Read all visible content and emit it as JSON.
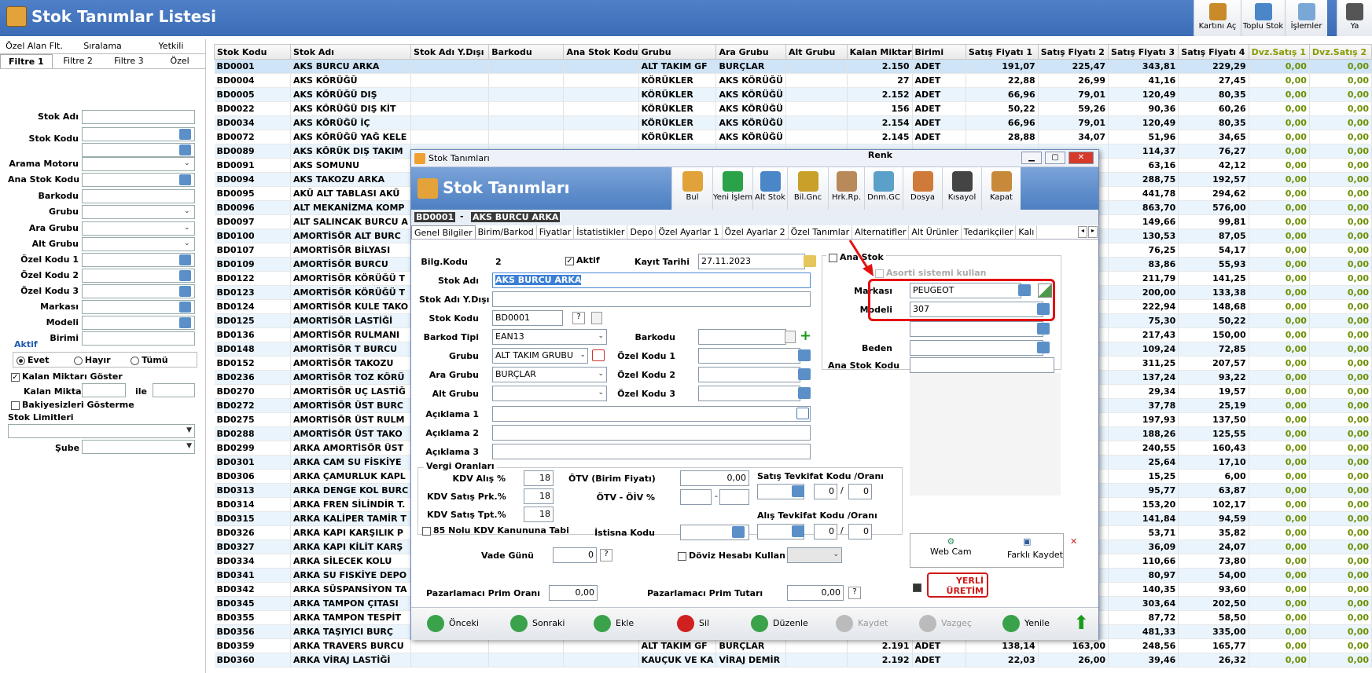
{
  "window": {
    "title": "Stok Tanımlar Listesi"
  },
  "toolbar": [
    {
      "label": "Kartını Aç"
    },
    {
      "label": "Toplu Stok"
    },
    {
      "label": "İşlemler"
    },
    {
      "label": "Ya"
    }
  ],
  "filter": {
    "tabs_top": [
      "Özel Alan Flt.",
      "Sıralama",
      "Yetkili"
    ],
    "tabs_bottom": [
      "Filtre 1",
      "Filtre 2",
      "Filtre 3",
      "Özel"
    ],
    "fields": [
      "Stok Adı",
      "Stok Kodu",
      "Arama Motoru",
      "Ana Stok Kodu",
      "Barkodu",
      "Grubu",
      "Ara Grubu",
      "Alt Grubu",
      "Özel Kodu 1",
      "Özel Kodu 2",
      "Özel Kodu 3",
      "Markası",
      "Modeli",
      "Birimi"
    ],
    "aktif_title": "Aktif",
    "aktif_options": [
      "Evet",
      "Hayır",
      "Tümü"
    ],
    "kalan_goster": "Kalan Miktarı Göster",
    "kalan_miktar": "Kalan Miktar",
    "ile": "ile",
    "bakiyesiz": "Bakiyesizleri Gösterme",
    "stok_limitleri": "Stok Limitleri",
    "sube": "Şube"
  },
  "grid": {
    "columns": [
      "Stok Kodu",
      "Stok Adı",
      "Stok Adı Y.Dışı",
      "Barkodu",
      "Ana Stok Kodu",
      "Grubu",
      "Ara Grubu",
      "Alt Grubu",
      "Kalan Miktar",
      "Birimi",
      "Satış Fiyatı 1",
      "Satış Fiyatı 2",
      "Satış Fiyatı 3",
      "Satış Fiyatı 4",
      "Dvz.Satış 1",
      "Dvz.Satış 2"
    ],
    "rows": [
      [
        "BD0001",
        "AKS BURCU ARKA",
        "",
        "",
        "",
        "ALT TAKIM GF",
        "BURÇLAR",
        "",
        "2.150",
        "ADET",
        "191,07",
        "225,47",
        "343,81",
        "229,29",
        "0,00",
        "0,00"
      ],
      [
        "BD0004",
        "AKS KÖRÜĞÜ",
        "",
        "",
        "",
        "KÖRÜKLER",
        "AKS KÖRÜĞÜ",
        "",
        "27",
        "ADET",
        "22,88",
        "26,99",
        "41,16",
        "27,45",
        "0,00",
        "0,00"
      ],
      [
        "BD0005",
        "AKS KÖRÜĞÜ DIŞ",
        "",
        "",
        "",
        "KÖRÜKLER",
        "AKS KÖRÜĞÜ",
        "",
        "2.152",
        "ADET",
        "66,96",
        "79,01",
        "120,49",
        "80,35",
        "0,00",
        "0,00"
      ],
      [
        "BD0022",
        "AKS KÖRÜĞÜ DIŞ KİT",
        "",
        "",
        "",
        "KÖRÜKLER",
        "AKS KÖRÜĞÜ",
        "",
        "156",
        "ADET",
        "50,22",
        "59,26",
        "90,36",
        "60,26",
        "0,00",
        "0,00"
      ],
      [
        "BD0034",
        "AKS KÖRÜĞÜ İÇ",
        "",
        "",
        "",
        "KÖRÜKLER",
        "AKS KÖRÜĞÜ",
        "",
        "2.154",
        "ADET",
        "66,96",
        "79,01",
        "120,49",
        "80,35",
        "0,00",
        "0,00"
      ],
      [
        "BD0072",
        "AKS KÖRÜĞÜ YAĞ KELE",
        "",
        "",
        "",
        "KÖRÜKLER",
        "AKS KÖRÜĞÜ",
        "",
        "2.145",
        "ADET",
        "28,88",
        "34,07",
        "51,96",
        "34,65",
        "0,00",
        "0,00"
      ],
      [
        "BD0089",
        "AKS KÖRÜK DIŞ TAKIM",
        "",
        "",
        "",
        "",
        "",
        "",
        "",
        "",
        "",
        "",
        "114,37",
        "76,27",
        "0,00",
        "0,00"
      ],
      [
        "BD0091",
        "AKS SOMUNU",
        "",
        "",
        "",
        "",
        "",
        "",
        "",
        "",
        "",
        "",
        "63,16",
        "42,12",
        "0,00",
        "0,00"
      ],
      [
        "BD0094",
        "AKS TAKOZU ARKA",
        "",
        "",
        "",
        "",
        "",
        "",
        "",
        "",
        "",
        "",
        "288,75",
        "192,57",
        "0,00",
        "0,00"
      ],
      [
        "BD0095",
        "AKÜ ALT TABLASI AKÜ",
        "",
        "",
        "",
        "",
        "",
        "",
        "",
        "",
        "",
        "",
        "441,78",
        "294,62",
        "0,00",
        "0,00"
      ],
      [
        "BD0096",
        "ALT MEKANİZMA KOMP",
        "",
        "",
        "",
        "",
        "",
        "",
        "",
        "",
        "",
        "",
        "863,70",
        "576,00",
        "0,00",
        "0,00"
      ],
      [
        "BD0097",
        "ALT SALINCAK BURCU A",
        "",
        "",
        "",
        "",
        "",
        "",
        "",
        "",
        "",
        "",
        "149,66",
        "99,81",
        "0,00",
        "0,00"
      ],
      [
        "BD0100",
        "AMORTİSÖR ALT BURC",
        "",
        "",
        "",
        "",
        "",
        "",
        "",
        "",
        "",
        "",
        "130,53",
        "87,05",
        "0,00",
        "0,00"
      ],
      [
        "BD0107",
        "AMORTİSÖR BİLYASI",
        "",
        "",
        "",
        "",
        "",
        "",
        "",
        "",
        "",
        "",
        "76,25",
        "54,17",
        "0,00",
        "0,00"
      ],
      [
        "BD0109",
        "AMORTİSÖR BURCU",
        "",
        "",
        "",
        "",
        "",
        "",
        "",
        "",
        "",
        "",
        "83,86",
        "55,93",
        "0,00",
        "0,00"
      ],
      [
        "BD0122",
        "AMORTİSÖR KÖRÜĞÜ T",
        "",
        "",
        "",
        "",
        "",
        "",
        "",
        "",
        "",
        "",
        "211,79",
        "141,25",
        "0,00",
        "0,00"
      ],
      [
        "BD0123",
        "AMORTİSÖR KÖRÜĞÜ T",
        "",
        "",
        "",
        "",
        "",
        "",
        "",
        "",
        "",
        "",
        "200,00",
        "133,38",
        "0,00",
        "0,00"
      ],
      [
        "BD0124",
        "AMORTİSÖR KULE TAKO",
        "",
        "",
        "",
        "",
        "",
        "",
        "",
        "",
        "",
        "",
        "222,94",
        "148,68",
        "0,00",
        "0,00"
      ],
      [
        "BD0125",
        "AMORTİSÖR LASTİĞİ",
        "",
        "",
        "",
        "",
        "",
        "",
        "",
        "",
        "",
        "",
        "75,30",
        "50,22",
        "0,00",
        "0,00"
      ],
      [
        "BD0136",
        "AMORTİSÖR RULMANI",
        "",
        "",
        "",
        "",
        "",
        "",
        "",
        "",
        "",
        "",
        "217,43",
        "150,00",
        "0,00",
        "0,00"
      ],
      [
        "BD0148",
        "AMORTİSÖR T BURCU",
        "",
        "",
        "",
        "",
        "",
        "",
        "",
        "",
        "",
        "",
        "109,24",
        "72,85",
        "0,00",
        "0,00"
      ],
      [
        "BD0152",
        "AMORTİSÖR TAKOZU",
        "",
        "",
        "",
        "",
        "",
        "",
        "",
        "",
        "",
        "",
        "311,25",
        "207,57",
        "0,00",
        "0,00"
      ],
      [
        "BD0236",
        "AMORTİSÖR TOZ KÖRÜ",
        "",
        "",
        "",
        "",
        "",
        "",
        "",
        "",
        "",
        "",
        "137,24",
        "93,22",
        "0,00",
        "0,00"
      ],
      [
        "BD0270",
        "AMORTİSÖR UÇ LASTİĞ",
        "",
        "",
        "",
        "",
        "",
        "",
        "",
        "",
        "",
        "",
        "29,34",
        "19,57",
        "0,00",
        "0,00"
      ],
      [
        "BD0272",
        "AMORTİSÖR ÜST BURC",
        "",
        "",
        "",
        "",
        "",
        "",
        "",
        "",
        "",
        "",
        "37,78",
        "25,19",
        "0,00",
        "0,00"
      ],
      [
        "BD0275",
        "AMORTİSÖR ÜST RULM",
        "",
        "",
        "",
        "",
        "",
        "",
        "",
        "",
        "",
        "",
        "197,93",
        "137,50",
        "0,00",
        "0,00"
      ],
      [
        "BD0288",
        "AMORTİSÖR ÜST TAKO",
        "",
        "",
        "",
        "",
        "",
        "",
        "",
        "",
        "",
        "",
        "188,26",
        "125,55",
        "0,00",
        "0,00"
      ],
      [
        "BD0299",
        "ARKA AMORTİSÖR ÜST",
        "",
        "",
        "",
        "",
        "",
        "",
        "",
        "",
        "",
        "",
        "240,55",
        "160,43",
        "0,00",
        "0,00"
      ],
      [
        "BD0301",
        "ARKA CAM SU FİSKİYE",
        "",
        "",
        "",
        "",
        "",
        "",
        "",
        "",
        "",
        "",
        "25,64",
        "17,10",
        "0,00",
        "0,00"
      ],
      [
        "BD0306",
        "ARKA ÇAMURLUK KAPL",
        "",
        "",
        "",
        "",
        "",
        "",
        "",
        "",
        "",
        "",
        "15,25",
        "6,00",
        "0,00",
        "0,00"
      ],
      [
        "BD0313",
        "ARKA DENGE KOL BURC",
        "",
        "",
        "",
        "",
        "",
        "",
        "",
        "",
        "",
        "",
        "95,77",
        "63,87",
        "0,00",
        "0,00"
      ],
      [
        "BD0314",
        "ARKA FREN SİLİNDİR T.",
        "",
        "",
        "",
        "",
        "",
        "",
        "",
        "",
        "",
        "",
        "153,20",
        "102,17",
        "0,00",
        "0,00"
      ],
      [
        "BD0315",
        "ARKA KALİPER TAMİR T",
        "",
        "",
        "",
        "",
        "",
        "",
        "",
        "",
        "",
        "",
        "141,84",
        "94,59",
        "0,00",
        "0,00"
      ],
      [
        "BD0326",
        "ARKA KAPI KARŞILIK P",
        "",
        "",
        "",
        "",
        "",
        "",
        "",
        "",
        "",
        "",
        "53,71",
        "35,82",
        "0,00",
        "0,00"
      ],
      [
        "BD0327",
        "ARKA KAPI KİLİT KARŞ",
        "",
        "",
        "",
        "",
        "",
        "",
        "",
        "",
        "",
        "",
        "36,09",
        "24,07",
        "0,00",
        "0,00"
      ],
      [
        "BD0334",
        "ARKA SİLECEK KOLU",
        "",
        "",
        "",
        "",
        "",
        "",
        "",
        "",
        "",
        "",
        "110,66",
        "73,80",
        "0,00",
        "0,00"
      ],
      [
        "BD0341",
        "ARKA SU FISKİYE DEPO",
        "",
        "",
        "",
        "",
        "",
        "",
        "",
        "",
        "",
        "",
        "80,97",
        "54,00",
        "0,00",
        "0,00"
      ],
      [
        "BD0342",
        "ARKA SÜSPANSİYON TA",
        "",
        "",
        "",
        "",
        "",
        "",
        "",
        "",
        "",
        "",
        "140,35",
        "93,60",
        "0,00",
        "0,00"
      ],
      [
        "BD0345",
        "ARKA TAMPON ÇITASI",
        "",
        "",
        "",
        "",
        "",
        "",
        "",
        "",
        "",
        "",
        "303,64",
        "202,50",
        "0,00",
        "0,00"
      ],
      [
        "BD0355",
        "ARKA TAMPON TESPİT",
        "",
        "",
        "",
        "",
        "",
        "",
        "",
        "",
        "",
        "",
        "87,72",
        "58,50",
        "0,00",
        "0,00"
      ],
      [
        "BD0356",
        "ARKA TAŞIYICI BURÇ",
        "",
        "",
        "",
        "",
        "",
        "",
        "",
        "",
        "",
        "",
        "481,33",
        "335,00",
        "0,00",
        "0,00"
      ],
      [
        "BD0359",
        "ARKA TRAVERS BURCU",
        "",
        "",
        "",
        "ALT TAKIM GF",
        "BURÇLAR",
        "",
        "2.191",
        "ADET",
        "138,14",
        "163,00",
        "248,56",
        "165,77",
        "0,00",
        "0,00"
      ],
      [
        "BD0360",
        "ARKA VİRAJ LASTİĞİ",
        "",
        "",
        "",
        "KAUÇUK VE KA",
        "VİRAJ DEMİR",
        "",
        "2.192",
        "ADET",
        "22,03",
        "26,00",
        "39,46",
        "26,32",
        "0,00",
        "0,00"
      ]
    ]
  },
  "dialog": {
    "caption": "Stok Tanımları",
    "header_title": "Stok Tanımları",
    "buttons": [
      "Bul",
      "Yeni İşlem",
      "Alt Stok",
      "Bil.Gnc",
      "Hrk.Rp.",
      "Dnm.GC",
      "Dosya",
      "Kısayol",
      "Kapat"
    ],
    "strip_code": "BD0001",
    "strip_sep": "-",
    "strip_name": "AKS BURCU ARKA",
    "tabs": [
      "Genel Bilgiler",
      "Birim/Barkod",
      "Fiyatlar",
      "İstatistikler",
      "Depo",
      "Özel Ayarlar 1",
      "Özel Ayarlar 2",
      "Özel Tanımlar",
      "Alternatifler",
      "Alt Ürünler",
      "Tedarikçiler",
      "Kalı"
    ],
    "bilg_kodu_label": "Bilg.Kodu",
    "bilg_kodu": "2",
    "aktif": "Aktif",
    "kayit_tarihi_label": "Kayıt Tarihi",
    "kayit_tarihi": "27.11.2023",
    "stok_adi_label": "Stok Adı",
    "stok_adi": "AKS BURCU ARKA",
    "stok_adi_yd_label": "Stok Adı Y.Dışı",
    "stok_kodu_label": "Stok Kodu",
    "stok_kodu": "BD0001",
    "barkod_tipi_label": "Barkod Tipi",
    "barkod_tipi": "EAN13",
    "barkodu_label": "Barkodu",
    "grubu_label": "Grubu",
    "grubu": "ALT TAKIM GRUBU",
    "ara_grubu_label": "Ara Grubu",
    "ara_grubu": "BURÇLAR",
    "alt_grubu_label": "Alt Grubu",
    "ozel1": "Özel Kodu 1",
    "ozel2": "Özel Kodu 2",
    "ozel3": "Özel Kodu 3",
    "aciklama1": "Açıklama 1",
    "aciklama2": "Açıklama 2",
    "aciklama3": "Açıklama 3",
    "vergi_title": "Vergi Oranları",
    "kdv_alis_label": "KDV Alış %",
    "kdv_alis": "18",
    "kdv_prk_label": "KDV Satış Prk.%",
    "kdv_prk": "18",
    "kdv_tpt_label": "KDV Satış Tpt.%",
    "kdv_tpt": "18",
    "kanun85": "85 Nolu KDV Kanununa Tabi",
    "otv_label": "ÖTV (Birim Fiyatı)",
    "otv": "0,00",
    "otv_oiv_label": "ÖTV - ÖİV %",
    "otv_oiv_sep": "-",
    "istisna_label": "İstisna Kodu",
    "satis_tevk_label": "Satış Tevkifat Kodu /Oranı",
    "alis_tevk_label": "Alış Tevkifat Kodu /Oranı",
    "tevk_val": "0",
    "tevk_sep": "/",
    "vade_label": "Vade Günü",
    "vade": "0",
    "q": "?",
    "doviz_label": "Döviz Hesabı Kullan",
    "prim_orani_label": "Pazarlamacı Prim Oranı",
    "prim_orani": "0,00",
    "prim_tutari_label": "Pazarlamacı Prim Tutarı",
    "prim_tutari": "0,00",
    "ana_stok": "Ana Stok",
    "asorti": "Asorti sistemi kullan",
    "markasi_label": "Markası",
    "markasi": "PEUGEOT",
    "modeli_label": "Modeli",
    "modeli": "307",
    "renk_label": "Renk",
    "beden_label": "Beden",
    "ana_stok_kodu_label": "Ana Stok Kodu",
    "webcam": "Web Cam",
    "farkli_kaydet": "Farklı Kaydet",
    "yerli_1": "YERLİ",
    "yerli_2": "ÜRETİM",
    "bottom": [
      "Önceki",
      "Sonraki",
      "Ekle",
      "Sil",
      "Düzenle",
      "Kaydet",
      "Vazgeç",
      "Yenile"
    ]
  },
  "colors": {
    "title_bar": "#3b6cb5",
    "highlight": "#e41010",
    "selected_row": "#cfe4f7"
  }
}
